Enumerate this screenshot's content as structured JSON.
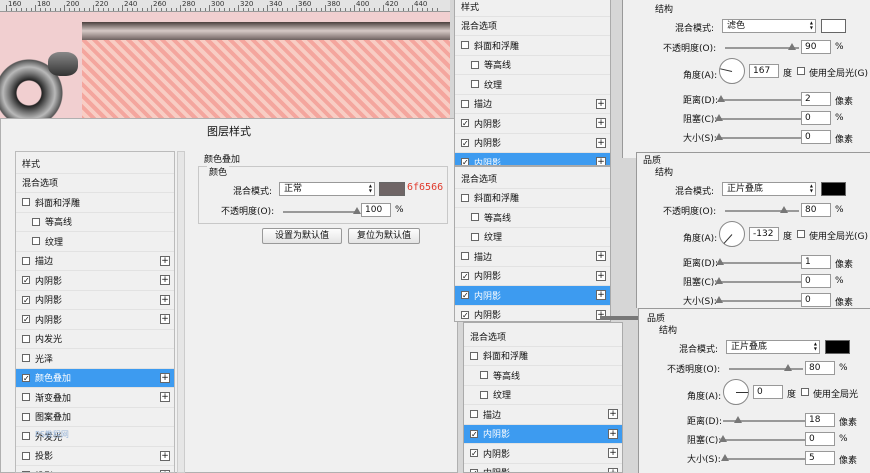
{
  "ruler": {
    "labels": [
      "160",
      "180",
      "200",
      "220",
      "240",
      "260",
      "280",
      "300",
      "320",
      "340",
      "360",
      "380",
      "400",
      "420",
      "440"
    ]
  },
  "dialog": {
    "title": "图层样式",
    "list": [
      {
        "label": "样式",
        "check": null,
        "plus": false,
        "selected": false,
        "indent": false
      },
      {
        "label": "混合选项",
        "check": null,
        "plus": false,
        "selected": false,
        "indent": false
      },
      {
        "label": "斜面和浮雕",
        "check": false,
        "plus": false,
        "selected": false,
        "indent": false
      },
      {
        "label": "等高线",
        "check": false,
        "plus": false,
        "selected": false,
        "indent": true
      },
      {
        "label": "纹理",
        "check": false,
        "plus": false,
        "selected": false,
        "indent": true
      },
      {
        "label": "描边",
        "check": false,
        "plus": true,
        "selected": false,
        "indent": false
      },
      {
        "label": "内阴影",
        "check": true,
        "plus": true,
        "selected": false,
        "indent": false
      },
      {
        "label": "内阴影",
        "check": true,
        "plus": true,
        "selected": false,
        "indent": false
      },
      {
        "label": "内阴影",
        "check": true,
        "plus": true,
        "selected": false,
        "indent": false
      },
      {
        "label": "内发光",
        "check": false,
        "plus": false,
        "selected": false,
        "indent": false
      },
      {
        "label": "光泽",
        "check": false,
        "plus": false,
        "selected": false,
        "indent": false
      },
      {
        "label": "颜色叠加",
        "check": true,
        "plus": true,
        "selected": true,
        "indent": false
      },
      {
        "label": "渐变叠加",
        "check": false,
        "plus": true,
        "selected": false,
        "indent": false
      },
      {
        "label": "图案叠加",
        "check": false,
        "plus": false,
        "selected": false,
        "indent": false
      },
      {
        "label": "外发光",
        "check": false,
        "plus": false,
        "selected": false,
        "indent": false
      },
      {
        "label": "投影",
        "check": false,
        "plus": true,
        "selected": false,
        "indent": false
      },
      {
        "label": "投影",
        "check": false,
        "plus": true,
        "selected": false,
        "indent": false
      }
    ],
    "overlay": {
      "section_title": "颜色叠加",
      "group_title": "颜色",
      "blend_label": "混合模式:",
      "blend_value": "正常",
      "color": "#6f6566",
      "color_hex_text": "6f6566",
      "opacity_label": "不透明度(O):",
      "opacity_value": "100",
      "opacity_fraction": 1.0,
      "percent": "%",
      "set_default": "设置为默认值",
      "reset_default": "复位为默认值"
    },
    "watermark": "PS教程网"
  },
  "mid_top": {
    "items": [
      {
        "label": "样式",
        "check": null,
        "plus": false,
        "selected": false,
        "indent": false
      },
      {
        "label": "混合选项",
        "check": null,
        "plus": false,
        "selected": false,
        "indent": false
      },
      {
        "label": "斜面和浮雕",
        "check": false,
        "plus": false,
        "selected": false,
        "indent": false
      },
      {
        "label": "等高线",
        "check": false,
        "plus": false,
        "selected": false,
        "indent": true
      },
      {
        "label": "纹理",
        "check": false,
        "plus": false,
        "selected": false,
        "indent": true
      },
      {
        "label": "描边",
        "check": false,
        "plus": true,
        "selected": false,
        "indent": false
      },
      {
        "label": "内阴影",
        "check": true,
        "plus": true,
        "selected": false,
        "indent": false
      },
      {
        "label": "内阴影",
        "check": true,
        "plus": true,
        "selected": false,
        "indent": false
      },
      {
        "label": "内阴影",
        "check": true,
        "plus": true,
        "selected": true,
        "indent": false
      }
    ]
  },
  "mid_mid": {
    "items": [
      {
        "label": "混合选项",
        "check": null,
        "plus": false,
        "selected": false,
        "indent": false
      },
      {
        "label": "斜面和浮雕",
        "check": false,
        "plus": false,
        "selected": false,
        "indent": false
      },
      {
        "label": "等高线",
        "check": false,
        "plus": false,
        "selected": false,
        "indent": true
      },
      {
        "label": "纹理",
        "check": false,
        "plus": false,
        "selected": false,
        "indent": true
      },
      {
        "label": "描边",
        "check": false,
        "plus": true,
        "selected": false,
        "indent": false
      },
      {
        "label": "内阴影",
        "check": true,
        "plus": true,
        "selected": false,
        "indent": false
      },
      {
        "label": "内阴影",
        "check": true,
        "plus": true,
        "selected": true,
        "indent": false
      },
      {
        "label": "内阴影",
        "check": true,
        "plus": true,
        "selected": false,
        "indent": false
      }
    ]
  },
  "mid_bot": {
    "items": [
      {
        "label": "混合选项",
        "check": null,
        "plus": false,
        "selected": false,
        "indent": false
      },
      {
        "label": "斜面和浮雕",
        "check": false,
        "plus": false,
        "selected": false,
        "indent": false
      },
      {
        "label": "等高线",
        "check": false,
        "plus": false,
        "selected": false,
        "indent": true
      },
      {
        "label": "纹理",
        "check": false,
        "plus": false,
        "selected": false,
        "indent": true
      },
      {
        "label": "描边",
        "check": false,
        "plus": true,
        "selected": false,
        "indent": false
      },
      {
        "label": "内阴影",
        "check": true,
        "plus": true,
        "selected": true,
        "indent": false
      },
      {
        "label": "内阴影",
        "check": true,
        "plus": true,
        "selected": false,
        "indent": false
      },
      {
        "label": "内阴影",
        "check": true,
        "plus": true,
        "selected": false,
        "indent": false
      }
    ]
  },
  "shadow1": {
    "structure": "结构",
    "blend_label": "混合模式:",
    "blend_value": "滤色",
    "color": "#ffffff",
    "opacity_label": "不透明度(O):",
    "opacity_value": "90",
    "opacity_fraction": 0.9,
    "angle_label": "角度(A):",
    "angle_value": "167",
    "angle_unit": "度",
    "global_light": "使用全局光(G)",
    "distance_label": "距离(D):",
    "distance_value": "2",
    "distance_fraction": 0.02,
    "choke_label": "阻塞(C):",
    "choke_value": "0",
    "choke_fraction": 0,
    "size_label": "大小(S):",
    "size_value": "0",
    "size_fraction": 0,
    "px": "像素",
    "percent": "%"
  },
  "shadow2": {
    "quality_title": "品质",
    "structure": "结构",
    "blend_label": "混合模式:",
    "blend_value": "正片叠底",
    "color": "#000000",
    "opacity_label": "不透明度(O):",
    "opacity_value": "80",
    "opacity_fraction": 0.8,
    "angle_label": "角度(A):",
    "angle_value": "-132",
    "angle_unit": "度",
    "global_light": "使用全局光(G)",
    "distance_label": "距离(D):",
    "distance_value": "1",
    "distance_fraction": 0.01,
    "choke_label": "阻塞(C):",
    "choke_value": "0",
    "choke_fraction": 0,
    "size_label": "大小(S):",
    "size_value": "0",
    "size_fraction": 0,
    "px": "像素",
    "percent": "%"
  },
  "shadow3": {
    "quality_title": "品质",
    "structure": "结构",
    "blend_label": "混合模式:",
    "blend_value": "正片叠底",
    "color": "#000000",
    "opacity_label": "不透明度(O):",
    "opacity_value": "80",
    "opacity_fraction": 0.8,
    "angle_label": "角度(A):",
    "angle_value": "0",
    "angle_unit": "度",
    "global_light": "使用全局光",
    "distance_label": "距离(D):",
    "distance_value": "18",
    "distance_fraction": 0.18,
    "choke_label": "阻塞(C):",
    "choke_value": "0",
    "choke_fraction": 0,
    "size_label": "大小(S):",
    "size_value": "5",
    "size_fraction": 0.03,
    "px": "像素",
    "percent": "%",
    "partial_label": "品质"
  }
}
